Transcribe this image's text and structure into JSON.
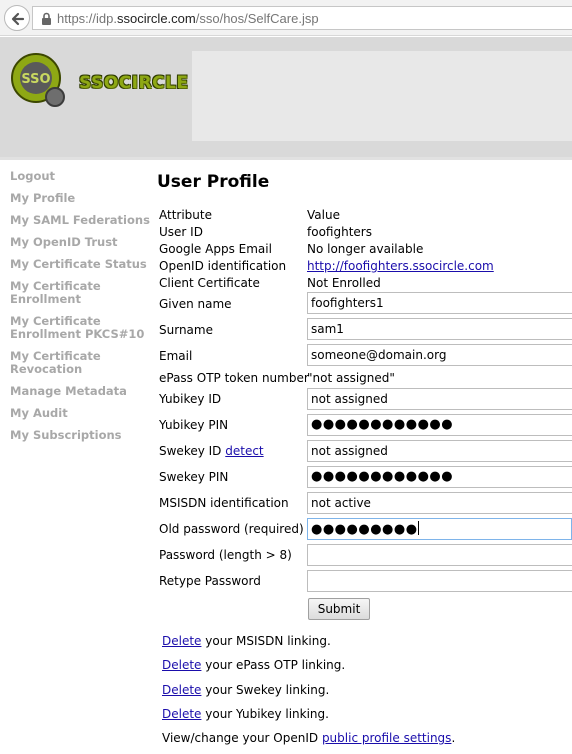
{
  "browser": {
    "url_scheme": "https://idp.",
    "url_domain": "ssocircle.com",
    "url_path": "/sso/hos/SelfCare.jsp"
  },
  "brand": {
    "logo_text": "SSO",
    "name": "SSOCIRCLE",
    "color": "#8ea814"
  },
  "sidebar": {
    "items": [
      {
        "label": "Logout"
      },
      {
        "label": "My Profile"
      },
      {
        "label": "My SAML Federations"
      },
      {
        "label": "My OpenID Trust"
      },
      {
        "label": "My Certificate Status"
      },
      {
        "label": "My Certificate\nEnrollment"
      },
      {
        "label": "My Certificate\nEnrollment PKCS#10"
      },
      {
        "label": "My Certificate\nRevocation"
      },
      {
        "label": "Manage Metadata"
      },
      {
        "label": "My Audit"
      },
      {
        "label": "My Subscriptions"
      }
    ]
  },
  "profile": {
    "title": "User Profile",
    "header": {
      "label": "Attribute",
      "value": "Value"
    },
    "user_id": {
      "label": "User ID",
      "value": "foofighters"
    },
    "google": {
      "label": "Google Apps Email",
      "value": "No longer available"
    },
    "openid": {
      "label": "OpenID identification",
      "value": "http://foofighters.ssocircle.com"
    },
    "cert": {
      "label": "Client Certificate",
      "value": "Not Enrolled"
    },
    "given_name": {
      "label": "Given name",
      "value": "foofighters1"
    },
    "surname": {
      "label": "Surname",
      "value": "sam1"
    },
    "email": {
      "label": "Email",
      "value": "someone@domain.org"
    },
    "epass": {
      "label": "ePass OTP token number",
      "value": "\"not assigned\""
    },
    "yubikey_id": {
      "label": "Yubikey ID",
      "value": "not assigned"
    },
    "yubikey_pin": {
      "label": "Yubikey PIN",
      "value": "●●●●●●●●●●●●"
    },
    "swekey_id": {
      "label": "Swekey ID",
      "link": "detect",
      "value": "not assigned"
    },
    "swekey_pin": {
      "label": "Swekey PIN",
      "value": "●●●●●●●●●●●●"
    },
    "msisdn": {
      "label": "MSISDN identification",
      "value": "not active"
    },
    "old_password": {
      "label": "Old password (required)",
      "value": "●●●●●●●●●"
    },
    "password": {
      "label": "Password (length > 8)",
      "value": ""
    },
    "retype": {
      "label": "Retype Password",
      "value": ""
    },
    "submit_label": "Submit"
  },
  "footer": {
    "delete_label": "Delete",
    "msisdn_text": " your MSISDN linking.",
    "epass_text": " your ePass OTP linking.",
    "swekey_text": " your Swekey linking.",
    "yubikey_text": " your Yubikey linking.",
    "openid_prefix": "View/change your OpenID ",
    "openid_link": "public profile settings",
    "openid_suffix": "."
  }
}
